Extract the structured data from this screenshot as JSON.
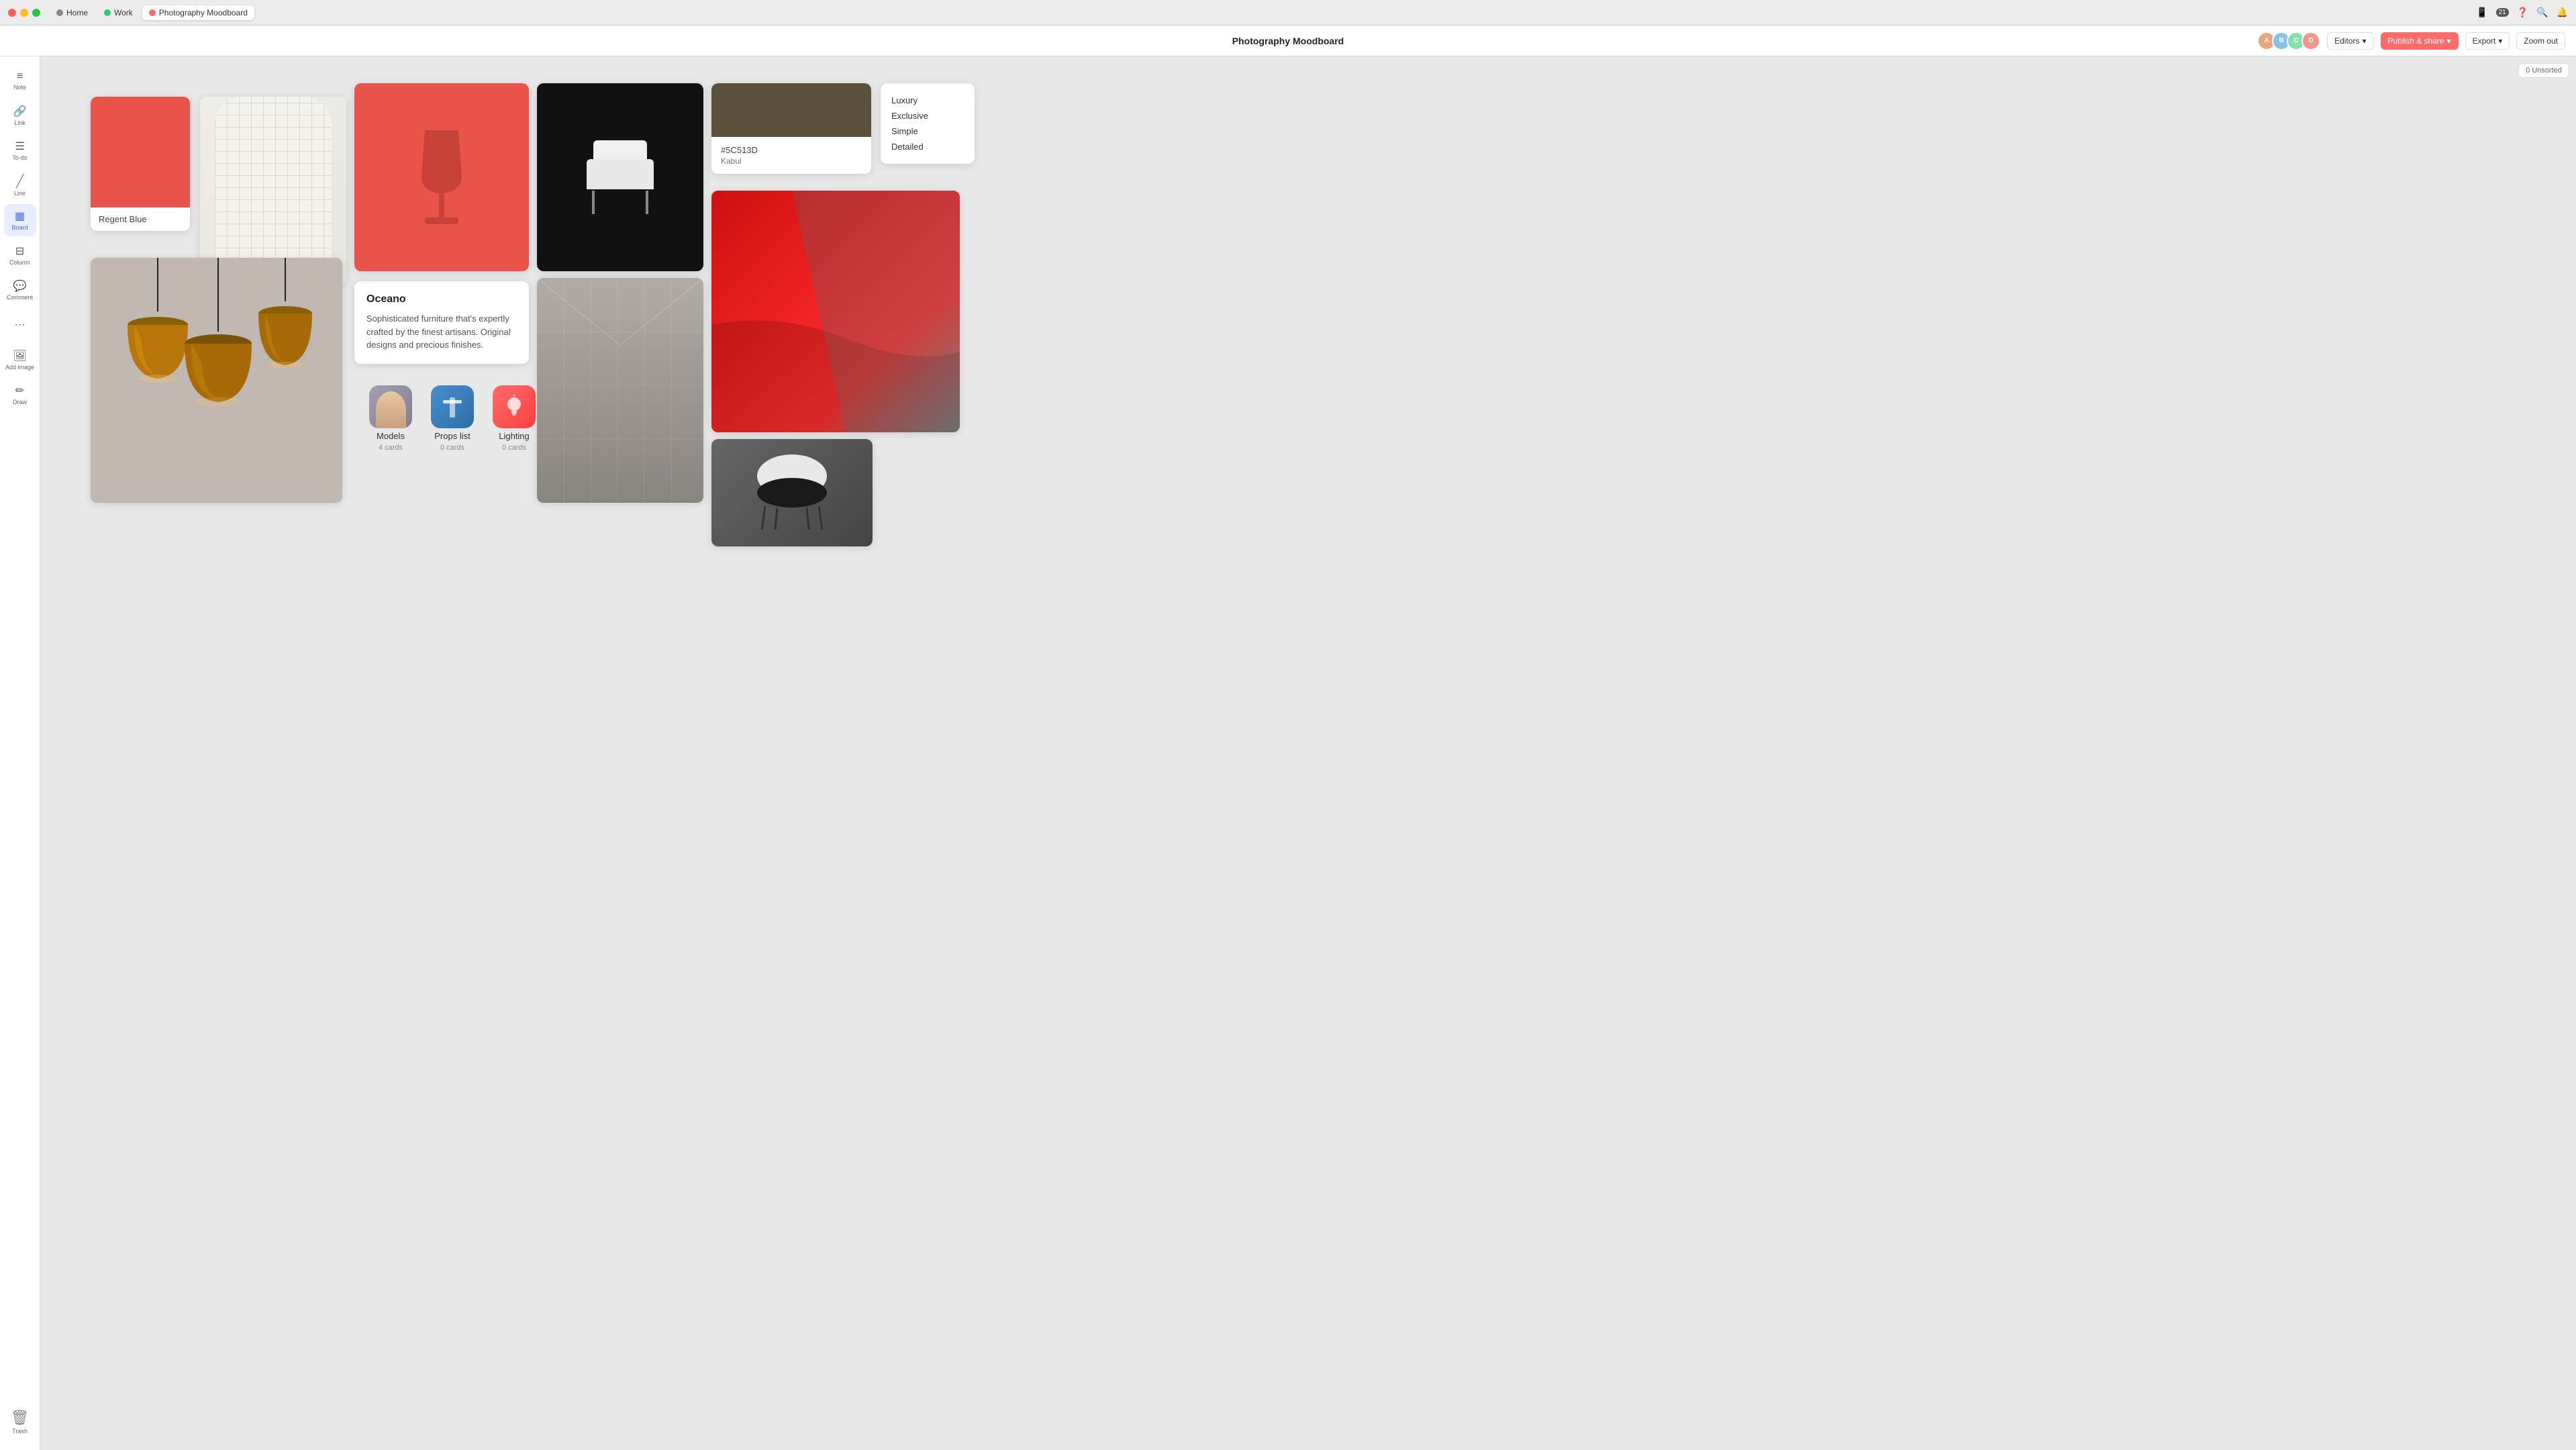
{
  "titleBar": {
    "tabs": [
      {
        "name": "Home",
        "active": false,
        "dotColor": "tab-home"
      },
      {
        "name": "Work",
        "active": false,
        "dotColor": "tab-work"
      },
      {
        "name": "Photography Moodboard",
        "active": true,
        "dotColor": "tab-board"
      }
    ],
    "notificationCount": "21"
  },
  "appBar": {
    "title": "Photography Moodboard",
    "editors": "Editors",
    "publishShare": "Publish & share",
    "export": "Export",
    "zoomOut": "Zoom out"
  },
  "sidebar": {
    "items": [
      {
        "id": "note",
        "label": "Note",
        "icon": "≡"
      },
      {
        "id": "link",
        "label": "Link",
        "icon": "⊕"
      },
      {
        "id": "todo",
        "label": "To-do",
        "icon": "☰"
      },
      {
        "id": "line",
        "label": "Line",
        "icon": "/"
      },
      {
        "id": "board",
        "label": "Board",
        "icon": "▦",
        "active": true
      },
      {
        "id": "column",
        "label": "Column",
        "icon": "≡"
      },
      {
        "id": "comment",
        "label": "Comment",
        "icon": "💬"
      },
      {
        "id": "more",
        "label": "",
        "icon": "···"
      },
      {
        "id": "add-image",
        "label": "Add image",
        "icon": "🖼"
      },
      {
        "id": "draw",
        "label": "Draw",
        "icon": "✏"
      }
    ],
    "trash": {
      "label": "Trash",
      "icon": "🗑"
    }
  },
  "canvas": {
    "sortButton": "0 Unsorted",
    "colorCard": {
      "swatchColor": "#e8534a",
      "hex": "#5C513D",
      "name": "Kabul",
      "swatchDarkColor": "#5C513D"
    },
    "tags": [
      "Luxury",
      "Exclusive",
      "Simple",
      "Detailed"
    ],
    "brandCard": {
      "title": "Oceano",
      "body": "Sophisticated furniture that's expertly crafted by the finest artisans. Original designs and precious finishes."
    },
    "colorLabel": "Regent Blue",
    "subBoards": [
      {
        "id": "models",
        "name": "Models",
        "count": "4 cards",
        "iconType": "models"
      },
      {
        "id": "props-list",
        "name": "Props list",
        "count": "0 cards",
        "iconType": "props"
      },
      {
        "id": "lighting",
        "name": "Lighting",
        "count": "0 cards",
        "iconType": "lighting"
      }
    ]
  }
}
